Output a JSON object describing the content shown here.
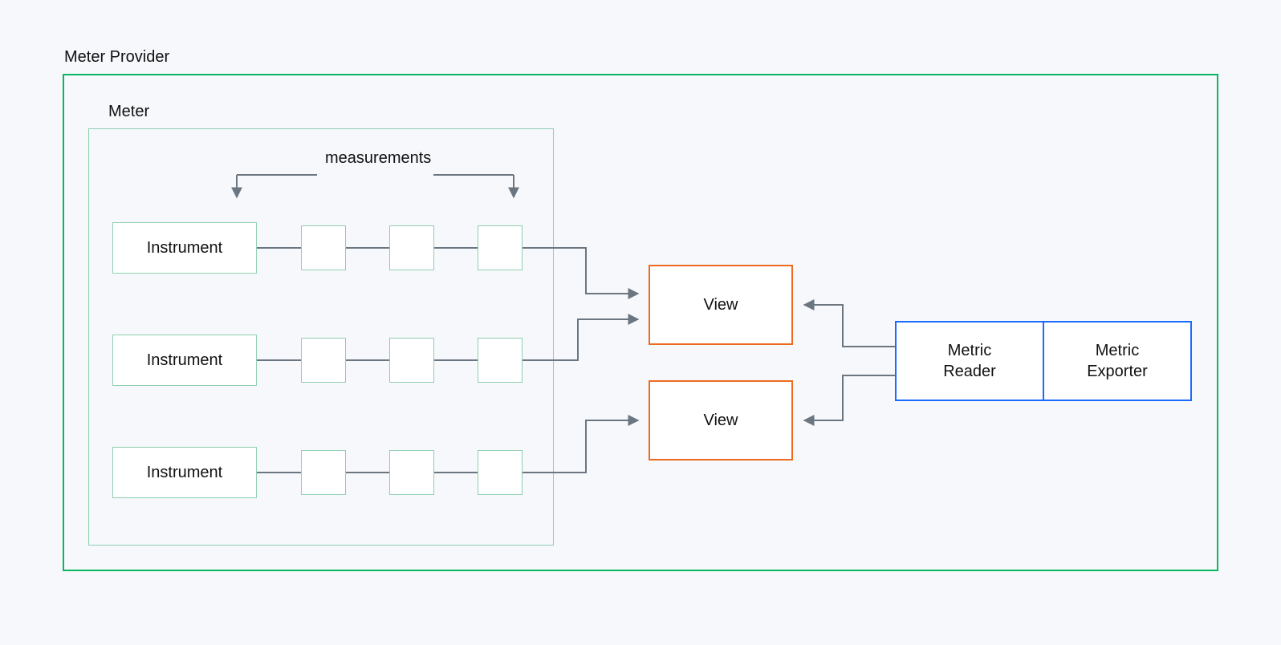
{
  "labels": {
    "meter_provider": "Meter Provider",
    "meter": "Meter",
    "measurements": "measurements",
    "instrument": "Instrument",
    "view": "View",
    "metric_reader": "Metric Reader",
    "metric_exporter": "Metric Exporter"
  },
  "colors": {
    "provider_border": "#06b85f",
    "meter_border": "#8fcfb0",
    "view_border": "#ec6b1f",
    "reader_border": "#1a6bff",
    "connector": "#6c7681",
    "background": "#f6f8fc",
    "box_fill": "#ffffff"
  },
  "diagram": {
    "instruments_count": 3,
    "measurements_per_instrument": 3,
    "views_count": 2,
    "reader_exporter_pair": true
  }
}
